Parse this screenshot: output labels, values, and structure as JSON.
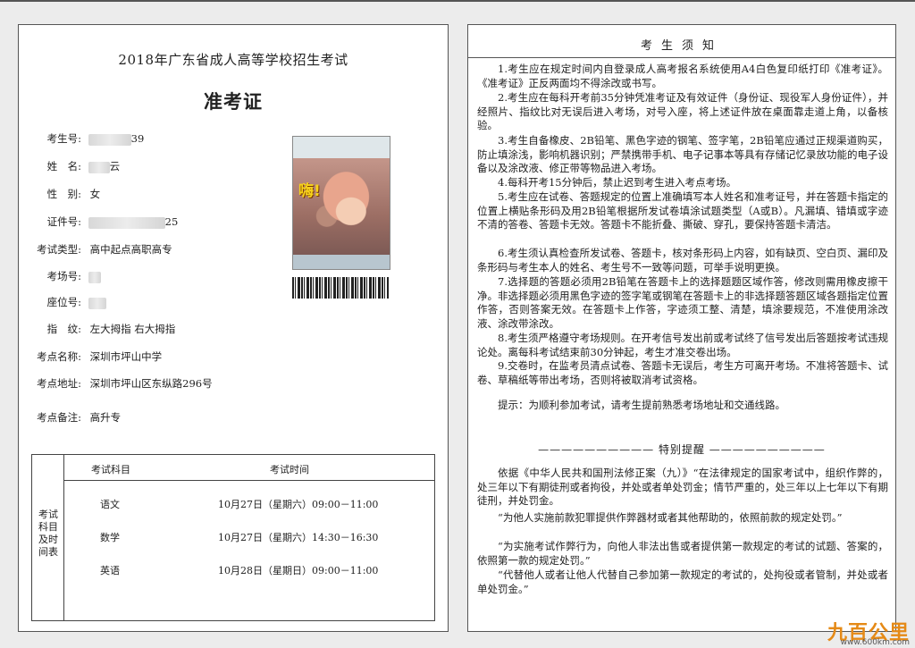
{
  "admission_card": {
    "exam_title": "2018年广东省成人高等学校招生考试",
    "card_title": "准考证",
    "fields": [
      {
        "label": "考生号:",
        "value": "39"
      },
      {
        "label": "姓　名:",
        "value": "云"
      },
      {
        "label": "性　别:",
        "value": "女"
      },
      {
        "label": "证件号:",
        "value": "25"
      },
      {
        "label": "考试类型:",
        "value": "高中起点高职高专"
      },
      {
        "label": "考场号:",
        "value": ""
      },
      {
        "label": "座位号:",
        "value": ""
      },
      {
        "label": "指　纹:",
        "value": "左大拇指 右大拇指"
      },
      {
        "label": "考点名称:",
        "value": "深圳市坪山中学"
      },
      {
        "label": "考点地址:",
        "value": "深圳市坪山区东纵路296号"
      },
      {
        "label": "考点备注:",
        "value": "高升专"
      }
    ],
    "photo_overlay_text": "嗨!",
    "schedule": {
      "side_label": "考试科目及时间表",
      "header_subject": "考试科目",
      "header_time": "考试时间",
      "rows": [
        {
          "subject": "语文",
          "time": "10月27日（星期六）09:00－11:00"
        },
        {
          "subject": "数学",
          "time": "10月27日（星期六）14:30－16:30"
        },
        {
          "subject": "英语",
          "time": "10月28日（星期日）09:00－11:00"
        }
      ]
    }
  },
  "notice": {
    "title": "考生须知",
    "items": [
      "1.考生应在规定时间内自登录成人高考报名系统使用A4白色复印纸打印《准考证》。《准考证》正反两面均不得涂改或书写。",
      "2.考生应在每科开考前35分钟凭准考证及有效证件（身份证、现役军人身份证件），并经照片、指纹比对无误后进入考场，对号入座，将上述证件放在桌面靠走道上角，以备核验。",
      "3.考生自备橡皮、2B铅笔、黑色字迹的钢笔、签字笔，2B铅笔应通过正规渠道购买，防止填涂浅，影响机器识别；严禁携带手机、电子记事本等具有存储记忆录放功能的电子设备以及涂改液、修正带等物品进入考场。",
      "4.每科开考15分钟后，禁止迟到考生进入考点考场。",
      "5.考生应在试卷、答题规定的位置上准确填写本人姓名和准考证号，并在答题卡指定的位置上横贴条形码及用2B铅笔根据所发试卷填涂试题类型（A或B）。凡漏填、错填或字迹不清的答卷、答题卡无效。答题卡不能折叠、撕破、穿孔，要保持答题卡清洁。",
      "6.考生须认真检查所发试卷、答题卡，核对条形码上内容，如有缺页、空白页、漏印及条形码与考生本人的姓名、考生号不一致等问题，可举手说明更换。",
      "7.选择题的答题必须用2B铅笔在答题卡上的选择题题区域作答，修改则需用橡皮擦干净。非选择题必须用黑色字迹的签字笔或钢笔在答题卡上的非选择题答题区域各题指定位置作答，否则答案无效。在答题卡上作答，字迹须工整、清楚，填涂要规范，不准使用涂改液、涂改带涂改。",
      "8.考生须严格遵守考场规则。在开考信号发出前或考试终了信号发出后答题按考试违规论处。离每科考试结束前30分钟起，考生才准交卷出场。",
      "9.交卷时，在监考员清点试卷、答题卡无误后，考生方可离开考场。不准将答题卡、试卷、草稿纸等带出考场，否则将被取消考试资格。"
    ],
    "tip": "提示：为顺利参加考试，请考生提前熟悉考场地址和交通线路。",
    "warning_title": "—————————— 特别提醒 ——————————",
    "warning_paras": [
      "依据《中华人民共和国刑法修正案（九）》“在法律规定的国家考试中，组织作弊的，处三年以下有期徒刑或者拘役，并处或者单处罚金；情节严重的，处三年以上七年以下有期徒刑，并处罚金。",
      "“为他人实施前款犯罪提供作弊器材或者其他帮助的，依照前款的规定处罚。”",
      "“为实施考试作弊行为，向他人非法出售或者提供第一款规定的考试的试题、答案的，依照第一款的规定处罚。”",
      "“代替他人或者让他人代替自己参加第一款规定的考试的，处拘役或者管制，并处或者单处罚金。”"
    ]
  },
  "watermark": {
    "logo": "九百公里",
    "url": "www.600km.com"
  }
}
